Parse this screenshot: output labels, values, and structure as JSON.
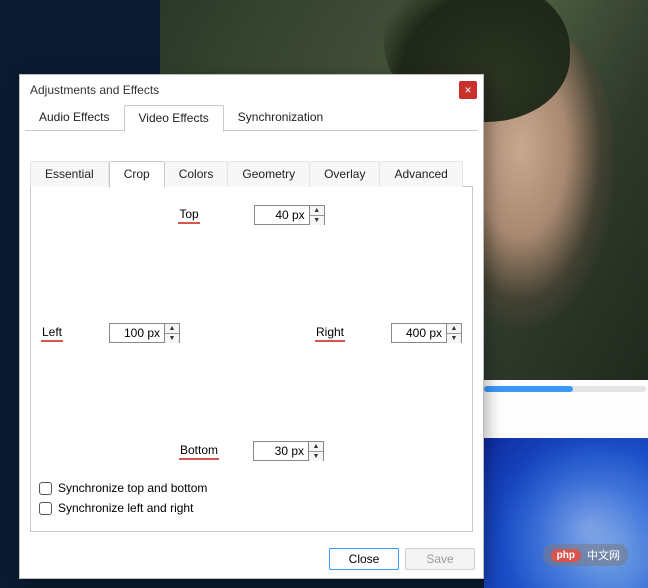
{
  "dialog": {
    "title": "Adjustments and Effects",
    "close_icon": "×"
  },
  "main_tabs": {
    "items": [
      {
        "label": "Audio Effects"
      },
      {
        "label": "Video Effects"
      },
      {
        "label": "Synchronization"
      }
    ],
    "active_index": 1
  },
  "sub_tabs": {
    "items": [
      {
        "label": "Essential"
      },
      {
        "label": "Crop"
      },
      {
        "label": "Colors"
      },
      {
        "label": "Geometry"
      },
      {
        "label": "Overlay"
      },
      {
        "label": "Advanced"
      }
    ],
    "active_index": 1
  },
  "crop": {
    "top_label": "Top",
    "top_value": "40 px",
    "left_label": "Left",
    "left_value": "100 px",
    "right_label": "Right",
    "right_value": "400 px",
    "bottom_label": "Bottom",
    "bottom_value": "30 px",
    "sync_tb_label": "Synchronize top and bottom",
    "sync_lr_label": "Synchronize left and right"
  },
  "buttons": {
    "close": "Close",
    "save": "Save"
  },
  "badge": {
    "brand": "php",
    "text": "中文网"
  }
}
